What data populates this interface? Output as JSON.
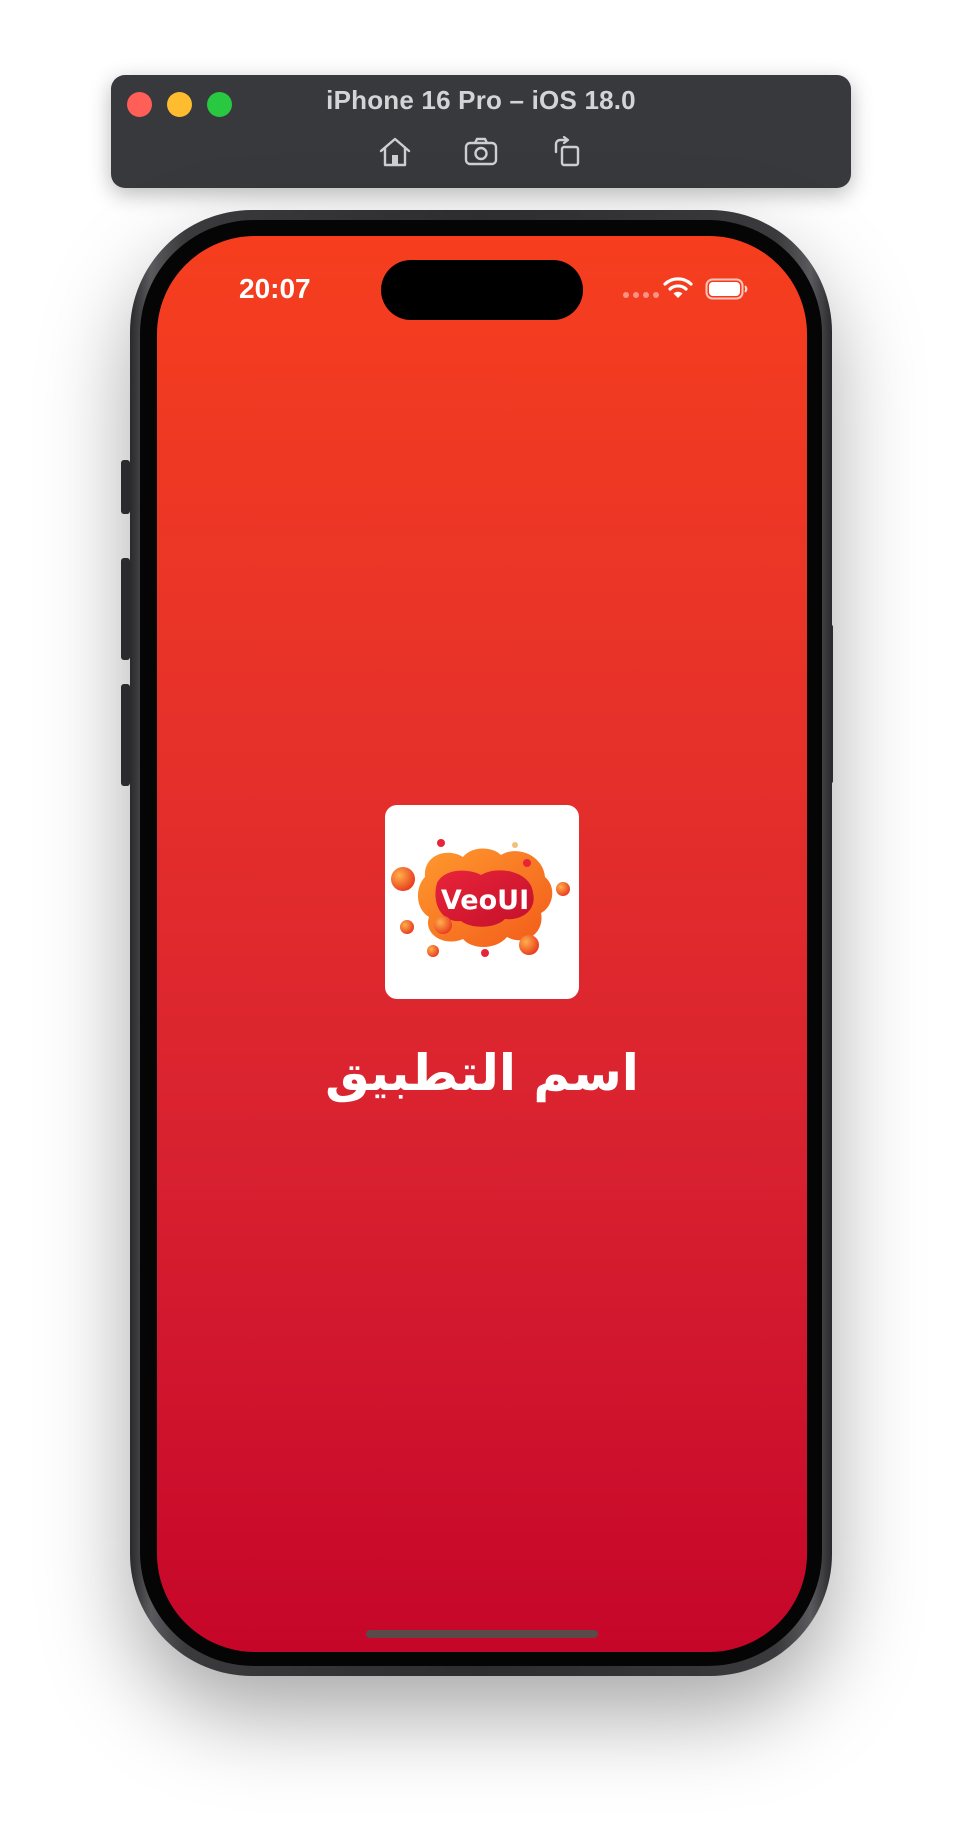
{
  "simulator": {
    "title": "iPhone 16 Pro – iOS 18.0",
    "tools": [
      {
        "name": "home-icon"
      },
      {
        "name": "screenshot-icon"
      },
      {
        "name": "rotate-icon"
      }
    ]
  },
  "status_bar": {
    "time": "20:07",
    "icons": [
      "cellular-dots-icon",
      "wifi-icon",
      "battery-icon"
    ]
  },
  "splash": {
    "logo_text": "VeoUI",
    "app_name": "اسم التطبيق"
  },
  "colors": {
    "gradient_top": "#f63e1e",
    "gradient_bottom": "#c60629",
    "text": "#ffffff"
  }
}
